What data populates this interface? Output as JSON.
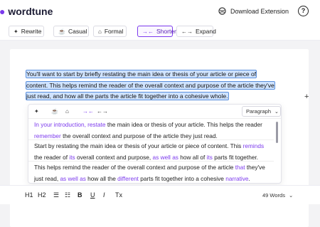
{
  "header": {
    "logo_mark": "●",
    "logo_text": "wordtune",
    "download_label": "Download Extension",
    "help_label": "?"
  },
  "toolbar": {
    "rewrite": "Rewrite",
    "casual": "Casual",
    "formal": "Formal",
    "shorten": "Shorten",
    "expand": "Expand",
    "active": "Shorten"
  },
  "document": {
    "selected_text": "You'll want to start by briefly restating the main idea or thesis of your article or piece of content. This helps remind the reader of the overall context and purpose of the article they've just read, and how all the parts the article fit together into a cohesive whole."
  },
  "popup": {
    "paragraph_select": "Paragraph",
    "suggestion_1": [
      {
        "t": "In your introduction, restate",
        "c": true
      },
      {
        "t": " the main idea or thesis of your article. This helps the reader ",
        "c": false
      },
      {
        "t": "remember",
        "c": true
      },
      {
        "t": " the overall context and purpose of the article they just read.",
        "c": false
      }
    ],
    "suggestion_2": [
      {
        "t": "Start by restating the main idea or thesis of your article or piece of content. This ",
        "c": false
      },
      {
        "t": "reminds",
        "c": true
      },
      {
        "t": " the reader of ",
        "c": false
      },
      {
        "t": "its",
        "c": true
      },
      {
        "t": " overall context and purpose, ",
        "c": false
      },
      {
        "t": "as well as",
        "c": true
      },
      {
        "t": " how all of ",
        "c": false
      },
      {
        "t": "its",
        "c": true
      },
      {
        "t": " parts fit together.",
        "c": false
      }
    ],
    "suggestion_3": [
      {
        "t": "This helps remind the reader of the overall context and purpose of the article ",
        "c": false
      },
      {
        "t": "that",
        "c": true
      },
      {
        "t": " they've just read, ",
        "c": false
      },
      {
        "t": "as well as",
        "c": true
      },
      {
        "t": " how all the ",
        "c": false
      },
      {
        "t": "different",
        "c": true
      },
      {
        "t": " parts fit together into a cohesive ",
        "c": false
      },
      {
        "t": "narrative",
        "c": true
      },
      {
        "t": ".",
        "c": false
      }
    ]
  },
  "format_bar": {
    "h1": "H1",
    "h2": "H2",
    "bold": "B",
    "underline": "U",
    "italic": "I",
    "clear": "Tx",
    "word_count": "49 Words"
  },
  "colors": {
    "accent": "#7c3aed",
    "selection": "#cfe3ff"
  },
  "icons": [
    "globe-icon",
    "help-icon",
    "rewrite-icon",
    "casual-icon",
    "formal-icon",
    "shorten-icon",
    "expand-icon",
    "chevron-down-icon"
  ]
}
